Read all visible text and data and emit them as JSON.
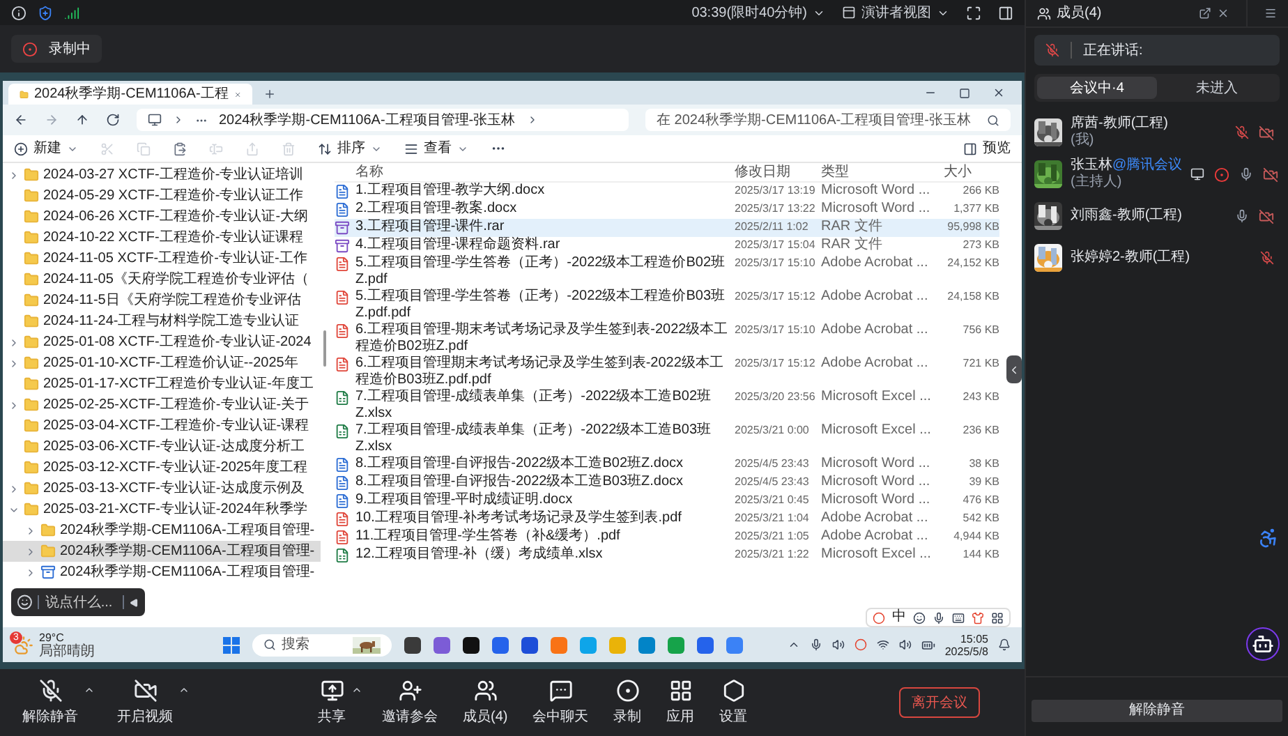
{
  "top_bar": {
    "timer": "03:39(限时40分钟)",
    "view_mode": "演讲者视图"
  },
  "recording_badge": "录制中",
  "explorer": {
    "tab_title": "2024秋季学期-CEM1106A-工程",
    "breadcrumb": "2024秋季学期-CEM1106A-工程项目管理-张玉林",
    "search_placeholder": "在 2024秋季学期-CEM1106A-工程项目管理-张玉林",
    "toolbar": {
      "new": "新建",
      "sort": "排序",
      "view": "查看",
      "preview": "预览"
    },
    "tree": [
      {
        "label": "2024-03-27 XCTF-工程造价-专业认证培训",
        "kind": "folder",
        "expanded": false,
        "selected": false
      },
      {
        "label": "2024-05-29 XCTF-工程造价-专业认证工作",
        "kind": "folder",
        "selected": false
      },
      {
        "label": "2024-06-26 XCTF-工程造价-专业认证-大纲",
        "kind": "folder",
        "selected": false
      },
      {
        "label": "2024-10-22 XCTF-工程造价-专业认证课程",
        "kind": "folder",
        "selected": false
      },
      {
        "label": "2024-11-05 XCTF-工程造价-专业认证-工作",
        "kind": "folder",
        "selected": false
      },
      {
        "label": "2024-11-05《天府学院工程造价专业评估（",
        "kind": "folder",
        "selected": false
      },
      {
        "label": "2024-11-5日《天府学院工程造价专业评估",
        "kind": "folder",
        "selected": false
      },
      {
        "label": "2024-11-24-工程与材料学院工造专业认证",
        "kind": "folder",
        "selected": false
      },
      {
        "label": "2025-01-08 XCTF-工程造价-专业认证-2024",
        "kind": "folder",
        "expanded": false,
        "selected": false
      },
      {
        "label": "2025-01-10-XCTF-工程造价认证--2025年",
        "kind": "folder",
        "expanded": false,
        "selected": false
      },
      {
        "label": "2025-01-17-XCTF工程造价专业认证-年度工",
        "kind": "folder",
        "selected": false
      },
      {
        "label": "2025-02-25-XCTF-工程造价-专业认证-关于",
        "kind": "folder",
        "expanded": false,
        "selected": false
      },
      {
        "label": "2025-03-04-XCTF-工程造价-专业认证-课程",
        "kind": "folder",
        "selected": false
      },
      {
        "label": "2025-03-06-XCTF-专业认证-达成度分析工",
        "kind": "folder",
        "selected": false
      },
      {
        "label": "2025-03-12-XCTF-专业认证-2025年度工程",
        "kind": "folder",
        "selected": false
      },
      {
        "label": "2025-03-13-XCTF-专业认证-达成度示例及",
        "kind": "folder",
        "expanded": false,
        "selected": false
      },
      {
        "label": "2025-03-21-XCTF-专业认证-2024年秋季学",
        "kind": "folder",
        "expanded": true,
        "selected": false,
        "children": [
          {
            "label": "2024秋季学期-CEM1106A-工程项目管理-",
            "kind": "folder",
            "expanded": false,
            "selected": false
          },
          {
            "label": "2024秋季学期-CEM1106A-工程项目管理-",
            "kind": "folder",
            "expanded": false,
            "selected": true
          },
          {
            "label": "2024秋季学期-CEM1106A-工程项目管理-",
            "kind": "archive",
            "expanded": false,
            "selected": false
          }
        ]
      }
    ],
    "columns": [
      "名称",
      "修改日期",
      "类型",
      "大小"
    ],
    "files": [
      {
        "name": "1.工程项目管理-教学大纲.docx",
        "modified": "2025/3/17 13:19",
        "type": "Microsoft Word ...",
        "size": "266 KB",
        "kind": "word",
        "selected": false
      },
      {
        "name": "2.工程项目管理-教案.docx",
        "modified": "2025/3/17 13:22",
        "type": "Microsoft Word ...",
        "size": "1,377 KB",
        "kind": "word",
        "selected": false
      },
      {
        "name": "3.工程项目管理-课件.rar",
        "modified": "2025/2/11 1:02",
        "type": "RAR 文件",
        "size": "95,998 KB",
        "kind": "rar",
        "selected": true
      },
      {
        "name": "4.工程项目管理-课程命题资料.rar",
        "modified": "2025/3/17 15:04",
        "type": "RAR 文件",
        "size": "273 KB",
        "kind": "rar",
        "selected": false
      },
      {
        "name": "5.工程项目管理-学生答卷（正考）-2022级本工程造价B02班Z.pdf",
        "modified": "2025/3/17 15:10",
        "type": "Adobe Acrobat ...",
        "size": "24,152 KB",
        "kind": "pdf",
        "selected": false
      },
      {
        "name": "5.工程项目管理-学生答卷（正考）-2022级本工程造价B03班Z.pdf.pdf",
        "modified": "2025/3/17 15:12",
        "type": "Adobe Acrobat ...",
        "size": "24,158 KB",
        "kind": "pdf",
        "selected": false
      },
      {
        "name": "6.工程项目管理-期末考试考场记录及学生签到表-2022级本工程造价B02班Z.pdf",
        "modified": "2025/3/17 15:10",
        "type": "Adobe Acrobat ...",
        "size": "756 KB",
        "kind": "pdf",
        "selected": false
      },
      {
        "name": "6.工程项目管理期末考试考场记录及学生签到表-2022级本工程造价B03班Z.pdf.pdf",
        "modified": "2025/3/17 15:12",
        "type": "Adobe Acrobat ...",
        "size": "721 KB",
        "kind": "pdf",
        "selected": false
      },
      {
        "name": "7.工程项目管理-成绩表单集（正考）-2022级本工造B02班Z.xlsx",
        "modified": "2025/3/20 23:56",
        "type": "Microsoft Excel ...",
        "size": "243 KB",
        "kind": "excel",
        "selected": false
      },
      {
        "name": "7.工程项目管理-成绩表单集（正考）-2022级本工造B03班Z.xlsx",
        "modified": "2025/3/21 0:00",
        "type": "Microsoft Excel ...",
        "size": "236 KB",
        "kind": "excel",
        "selected": false
      },
      {
        "name": "8.工程项目管理-自评报告-2022级本工造B02班Z.docx",
        "modified": "2025/4/5 23:43",
        "type": "Microsoft Word ...",
        "size": "38 KB",
        "kind": "word",
        "selected": false
      },
      {
        "name": "8.工程项目管理-自评报告-2022级本工造B03班Z.docx",
        "modified": "2025/4/5 23:43",
        "type": "Microsoft Word ...",
        "size": "39 KB",
        "kind": "word",
        "selected": false
      },
      {
        "name": "9.工程项目管理-平时成绩证明.docx",
        "modified": "2025/3/21 0:45",
        "type": "Microsoft Word ...",
        "size": "476 KB",
        "kind": "word",
        "selected": false
      },
      {
        "name": "10.工程项目管理-补考考试考场记录及学生签到表.pdf",
        "modified": "2025/3/21 1:04",
        "type": "Adobe Acrobat ...",
        "size": "542 KB",
        "kind": "pdf",
        "selected": false
      },
      {
        "name": "11.工程项目管理-学生答卷（补&缓考）.pdf",
        "modified": "2025/3/21 1:05",
        "type": "Adobe Acrobat ...",
        "size": "4,944 KB",
        "kind": "pdf",
        "selected": false
      },
      {
        "name": "12.工程项目管理-补（缓）考成绩单.xlsx",
        "modified": "2025/3/21 1:22",
        "type": "Microsoft Excel ...",
        "size": "144 KB",
        "kind": "excel",
        "selected": false
      }
    ]
  },
  "chat_input": {
    "placeholder": "说点什么..."
  },
  "ime_bar": {
    "mode": "中"
  },
  "taskbar": {
    "weather_badge": "3",
    "temperature": "29°C",
    "weather": "局部晴朗",
    "search_placeholder": "搜索",
    "time": "15:05",
    "date": "2025/5/8"
  },
  "meeting_toolbar": {
    "left": [
      {
        "label": "解除静音",
        "kind": "mic-off",
        "has_menu": true
      },
      {
        "label": "开启视频",
        "kind": "video-off",
        "has_menu": true
      }
    ],
    "center": [
      {
        "label": "共享",
        "kind": "share",
        "has_menu": true
      },
      {
        "label": "邀请参会",
        "kind": "invite",
        "has_menu": false
      },
      {
        "label": "成员(4)",
        "kind": "members",
        "has_menu": false
      },
      {
        "label": "会中聊天",
        "kind": "chat",
        "has_menu": false
      },
      {
        "label": "录制",
        "kind": "record",
        "has_menu": false
      },
      {
        "label": "应用",
        "kind": "apps",
        "has_menu": false
      },
      {
        "label": "设置",
        "kind": "settings",
        "has_menu": false
      }
    ],
    "leave": "离开会议"
  },
  "members_panel": {
    "title": "成员(4)",
    "speaking_label": "正在讲话:",
    "tabs": [
      {
        "label": "会议中·4",
        "selected": true
      },
      {
        "label": "未进入",
        "selected": false
      }
    ],
    "members": [
      {
        "name": "席茜-教师(工程)",
        "role": "(我)",
        "sharing": false,
        "recording": false,
        "muted": true,
        "video_off": true
      },
      {
        "name": "张玉林",
        "tag": "@腾讯会议",
        "role": "(主持人)",
        "sharing": true,
        "recording": true,
        "muted": false,
        "video_off": true
      },
      {
        "name": "刘雨鑫-教师(工程)",
        "sharing": false,
        "recording": false,
        "muted": false,
        "video_off": true
      },
      {
        "name": "张婷婷2-教师(工程)",
        "sharing": false,
        "recording": false,
        "muted": true,
        "video_off": false
      }
    ],
    "unmute_button": "解除静音"
  }
}
